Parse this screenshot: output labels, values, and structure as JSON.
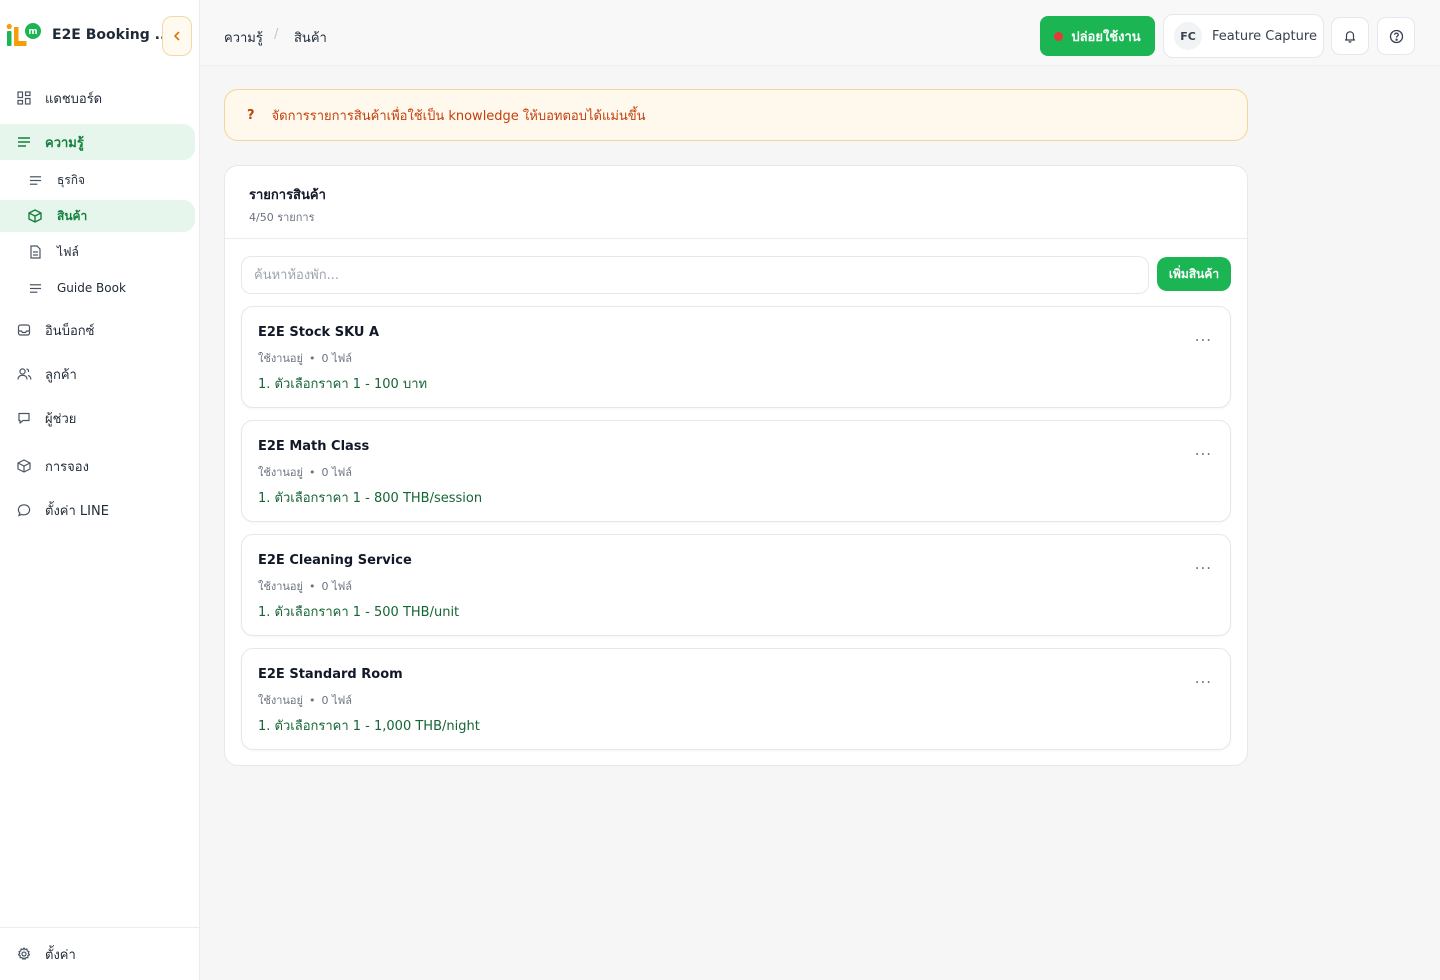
{
  "brand": {
    "name": "E2E Booking ...",
    "collapse_icon": "chevron-left-icon"
  },
  "sidebar": {
    "items": [
      {
        "label": "แดชบอร์ด",
        "icon": "dashboard-grid-icon"
      },
      {
        "label": "ความรู้",
        "icon": "list-lines-icon",
        "active": true
      },
      {
        "label": "อินบ็อกซ์",
        "icon": "inbox-icon"
      },
      {
        "label": "ลูกค้า",
        "icon": "users-icon"
      },
      {
        "label": "ผู้ช่วย",
        "icon": "chat-bubble-icon"
      },
      {
        "label": "การจอง",
        "icon": "box-icon"
      },
      {
        "label": "ตั้งค่า LINE",
        "icon": "line-chat-icon"
      }
    ],
    "sub_items": [
      {
        "label": "ธุรกิจ",
        "icon": "list-lines-icon"
      },
      {
        "label": "สินค้า",
        "icon": "box-icon",
        "active": true
      },
      {
        "label": "ไฟล์",
        "icon": "file-icon"
      },
      {
        "label": "Guide Book",
        "icon": "list-lines-icon"
      }
    ],
    "footer": {
      "label": "ตั้งค่า",
      "icon": "gear-icon"
    }
  },
  "topbar": {
    "breadcrumb": [
      "ความรู้",
      "สินค้า"
    ],
    "breadcrumb_sep": "/",
    "deploy_label": "ปล่อยใช้งาน",
    "user_initials": "FC",
    "user_name": "Feature Capture",
    "bell_icon": "bell-icon",
    "help_icon": "help-circle-icon"
  },
  "notice": {
    "mark": "?",
    "text": "จัดการรายการสินค้าเพื่อใช้เป็น knowledge ให้บอทตอบได้แม่นขึ้น"
  },
  "panel": {
    "title": "รายการสินค้า",
    "count": "4/50 รายการ",
    "search_placeholder": "ค้นหาห้องพัก...",
    "add_label": "เพิ่มสินค้า"
  },
  "products": [
    {
      "name": "E2E Stock SKU A",
      "status": "ใช้งานอยู่",
      "files": "0 ไฟล์",
      "price": "1. ตัวเลือกราคา 1 - 100 บาท"
    },
    {
      "name": "E2E Math Class",
      "status": "ใช้งานอยู่",
      "files": "0 ไฟล์",
      "price": "1. ตัวเลือกราคา 1 - 800 THB/session"
    },
    {
      "name": "E2E Cleaning Service",
      "status": "ใช้งานอยู่",
      "files": "0 ไฟล์",
      "price": "1. ตัวเลือกราคา 1 - 500 THB/unit"
    },
    {
      "name": "E2E Standard Room",
      "status": "ใช้งานอยู่",
      "files": "0 ไฟล์",
      "price": "1. ตัวเลือกราคา 1 - 1,000 THB/night"
    }
  ],
  "meta_dot": "•",
  "more_label": "...",
  "colors": {
    "accent": "#1cb553",
    "active_bg": "#e6f6ec",
    "active_text": "#15803d",
    "notice_text": "#c2410c",
    "price_text": "#166534"
  }
}
